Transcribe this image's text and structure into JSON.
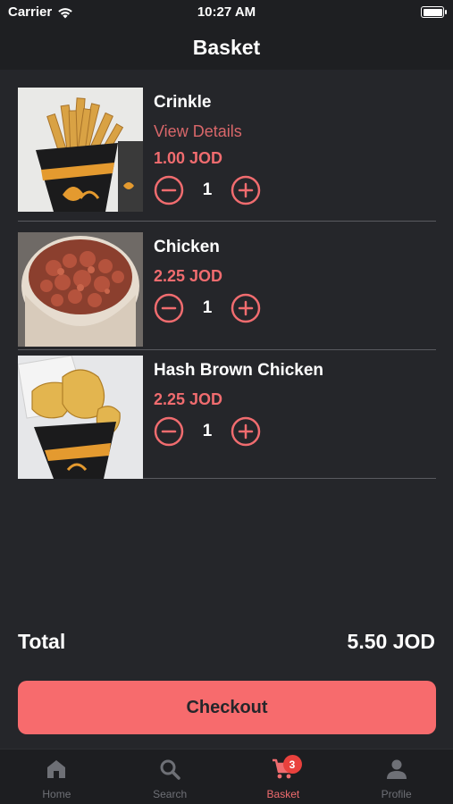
{
  "status_bar": {
    "carrier": "Carrier",
    "time": "10:27 AM"
  },
  "nav": {
    "title": "Basket"
  },
  "items": [
    {
      "name": "Crinkle",
      "details_link": "View Details",
      "price": "1.00 JOD",
      "quantity": "1"
    },
    {
      "name": "Chicken",
      "price": "2.25 JOD",
      "quantity": "1"
    },
    {
      "name": "Hash Brown Chicken",
      "price": "2.25 JOD",
      "quantity": "1"
    }
  ],
  "summary": {
    "total_label": "Total",
    "total_value": "5.50 JOD"
  },
  "checkout": {
    "label": "Checkout"
  },
  "tabs": [
    {
      "label": "Home",
      "icon": "home-icon"
    },
    {
      "label": "Search",
      "icon": "search-icon"
    },
    {
      "label": "Basket",
      "icon": "cart-icon",
      "badge": "3",
      "active": true
    },
    {
      "label": "Profile",
      "icon": "person-icon"
    }
  ],
  "colors": {
    "accent": "#f06c6f",
    "background": "#25262a",
    "bar": "#1e1f22",
    "badge": "#e9413d"
  }
}
